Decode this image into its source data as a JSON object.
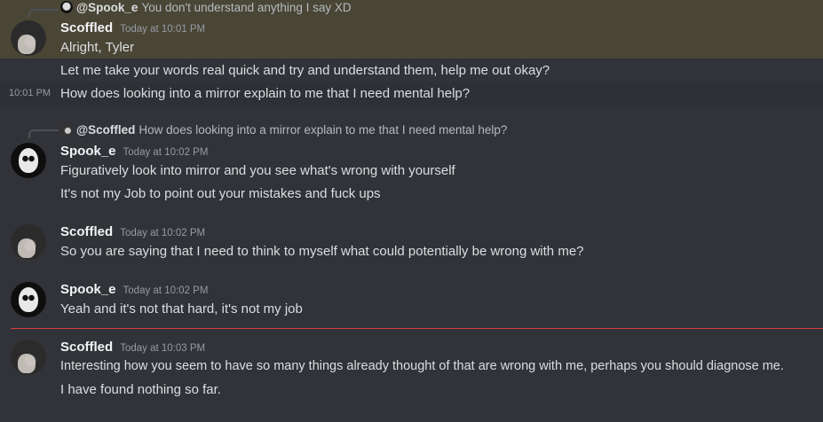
{
  "messages": [
    {
      "reply": {
        "name": "@Spook_e",
        "text": "You don't understand anything I say XD"
      },
      "author": "Scoffled",
      "timestamp": "Today at 10:01 PM",
      "lines": [
        "Alright, Tyler",
        "Let me take your words real quick and try and understand them, help me out okay?",
        "How does looking into a mirror explain to me that I need mental help?"
      ],
      "hover_time": "10:01 PM"
    },
    {
      "reply": {
        "name": "@Scoffled",
        "text": "How does looking into a mirror explain to me that I need mental help?"
      },
      "author": "Spook_e",
      "timestamp": "Today at 10:02 PM",
      "lines": [
        "Figuratively look into mirror and you see what's wrong with yourself",
        "It's not my Job to point out your mistakes and fuck ups"
      ]
    },
    {
      "author": "Scoffled",
      "timestamp": "Today at 10:02 PM",
      "lines": [
        "So you are saying that I need to think to myself what could potentially be wrong with me?"
      ]
    },
    {
      "author": "Spook_e",
      "timestamp": "Today at 10:02 PM",
      "lines": [
        "Yeah and it's not that hard, it's not my job"
      ]
    },
    {
      "author": "Scoffled",
      "timestamp": "Today at 10:03 PM",
      "lines": [
        "Interesting how you seem to have so many things already thought of that are wrong with me, perhaps you should diagnose me.",
        "I have found nothing so far."
      ]
    }
  ],
  "colors": {
    "background": "#313338",
    "mention_highlight": "#4a4636",
    "new_messages_divider": "#d83c3e"
  }
}
